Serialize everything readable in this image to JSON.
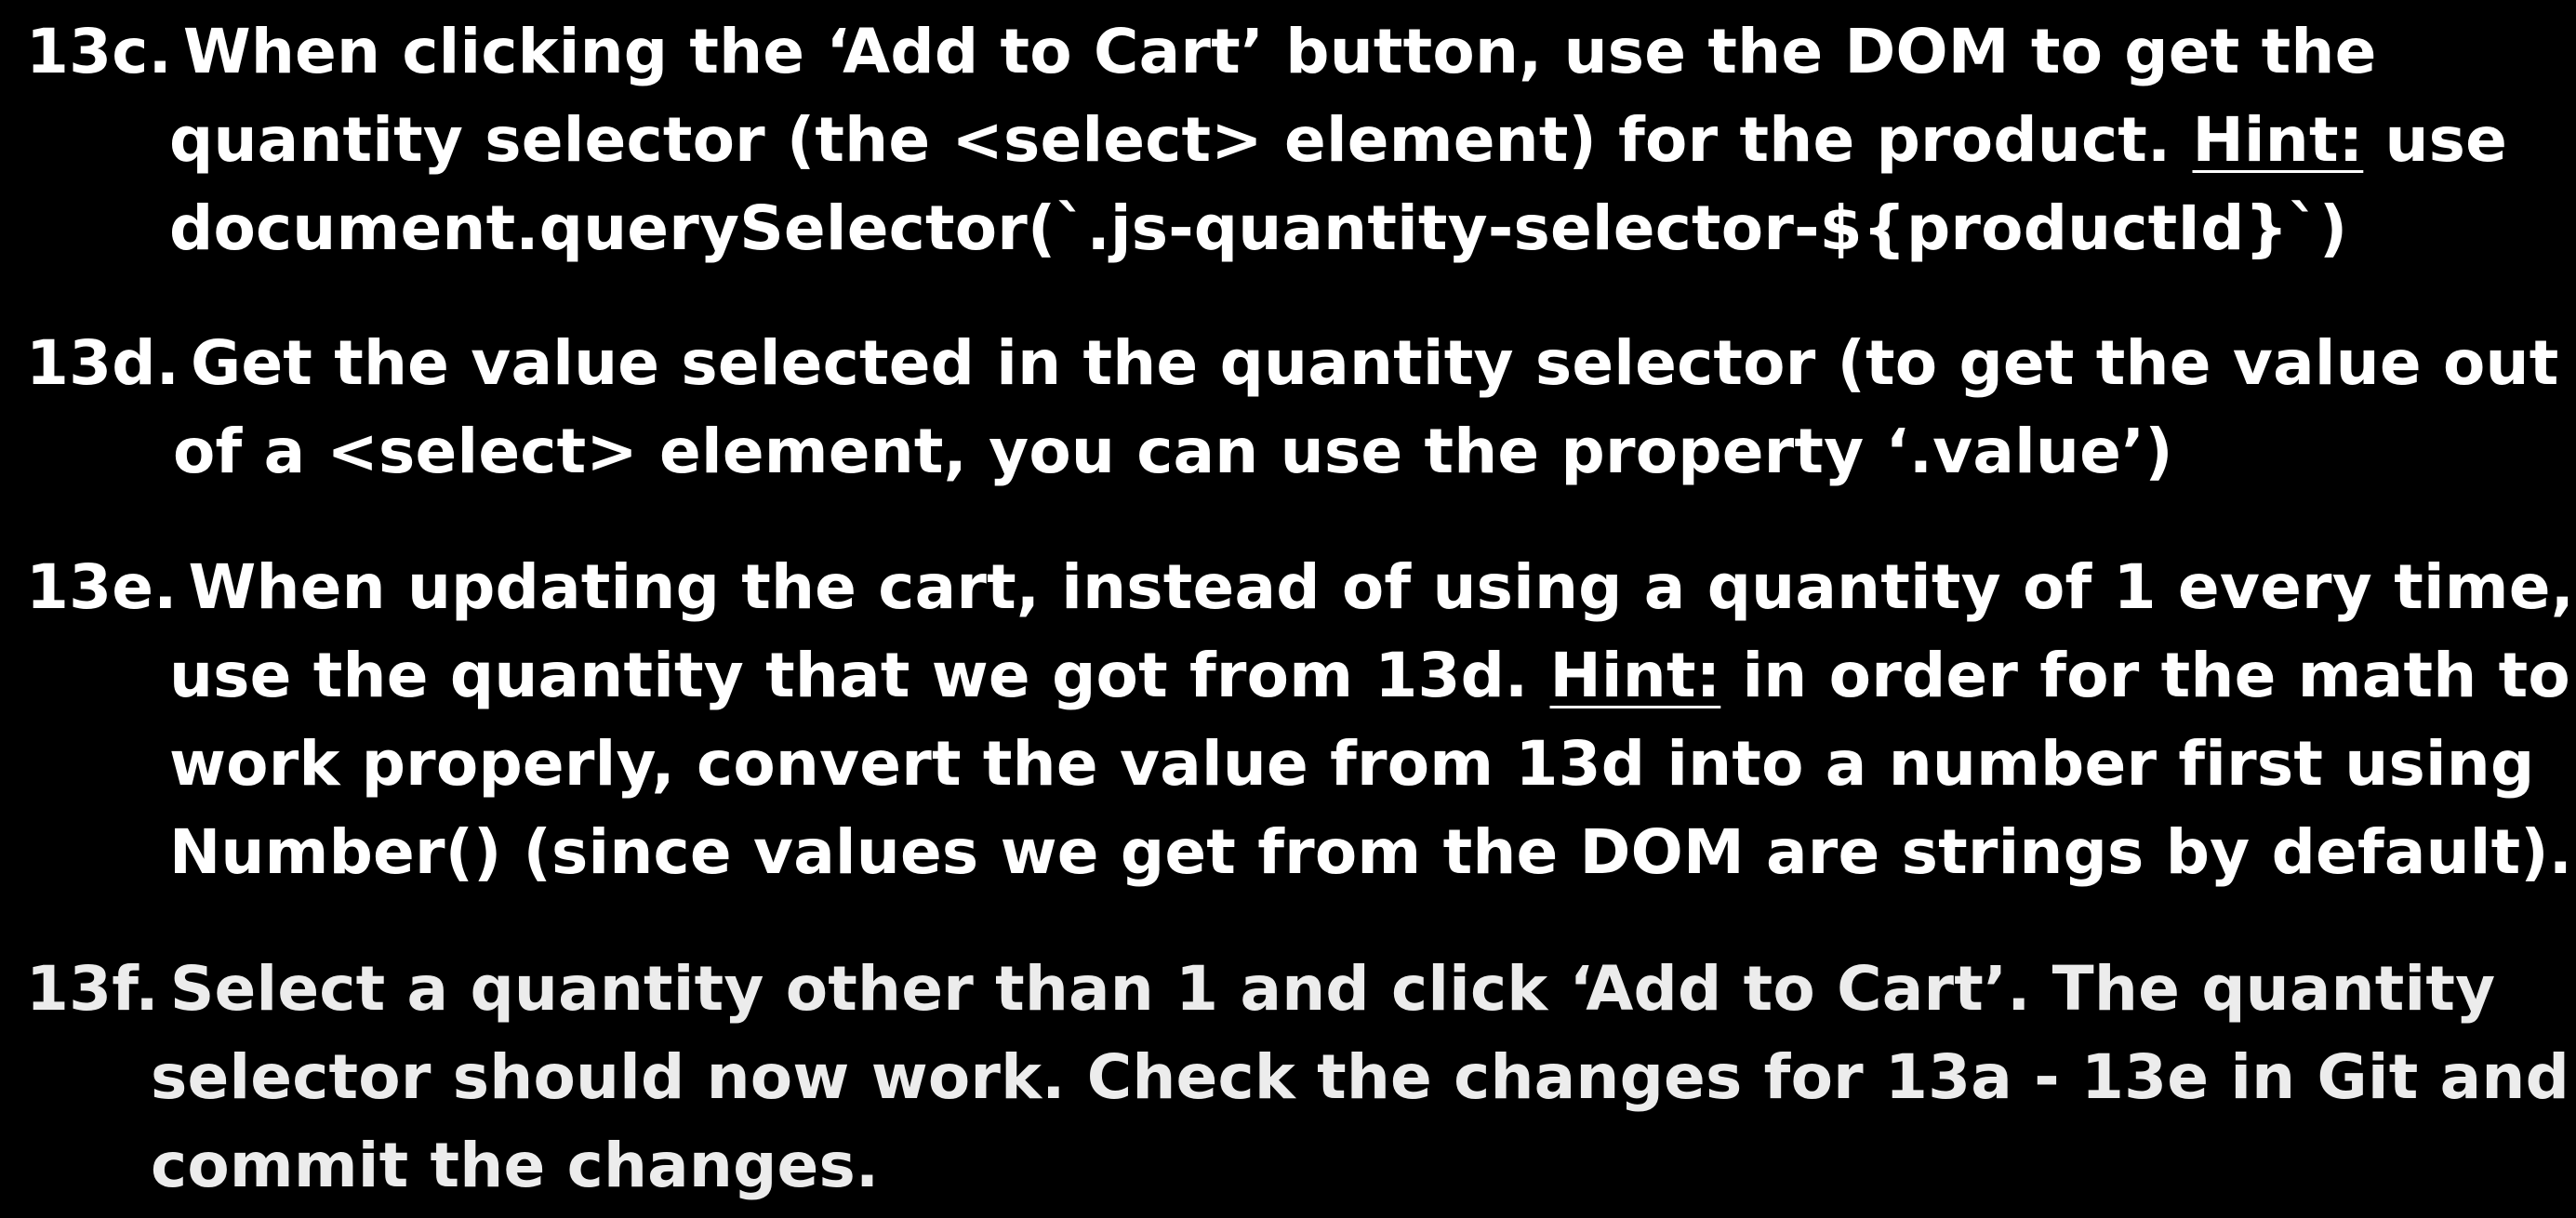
{
  "colors": {
    "background": "#000000",
    "text": "#ffffff",
    "last_item_text": "#ececec"
  },
  "item_13c": {
    "label": "13c.",
    "line1": "When clicking the ‘Add to Cart’ button, use the DOM to get the",
    "line2_a": "quantity selector (the <select> element) for the product.",
    "line2_hint": "Hint:",
    "line2_b": "use",
    "line3": "document.querySelector(`.js-quantity-selector-${productId}`)"
  },
  "item_13d": {
    "label": "13d.",
    "line1": "Get the value selected in the quantity selector (to get the value out",
    "line2": "of a <select> element, you can use the property ‘.value’)"
  },
  "item_13e": {
    "label": "13e.",
    "line1": "When updating the cart, instead of using a quantity of 1 every time,",
    "line2_a": "use the quantity that we got from 13d.",
    "line2_hint": "Hint:",
    "line2_b": "in order for the math to",
    "line3": "work properly, convert the value from 13d into a number first using",
    "line4": "Number() (since values we get from the DOM are strings by default)."
  },
  "item_13f": {
    "label": "13f.",
    "line1": "Select a quantity other than 1 and click ‘Add to Cart’. The quantity",
    "line2": "selector should now work. Check the changes for 13a - 13e in Git and",
    "line3": "commit the changes."
  }
}
